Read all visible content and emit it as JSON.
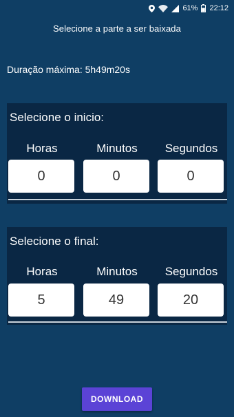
{
  "status_bar": {
    "battery": "61%",
    "time": "22:12",
    "icons": [
      "location-icon",
      "wifi-icon",
      "signal-icon",
      "battery-icon"
    ]
  },
  "header": {
    "title": "Selecione a parte a ser baixada"
  },
  "duration": {
    "text": "Duração máxima: 5h49m20s"
  },
  "start": {
    "title": "Selecione o inicio:",
    "labels": {
      "hours": "Horas",
      "minutes": "Minutos",
      "seconds": "Segundos"
    },
    "values": {
      "hours": "0",
      "minutes": "0",
      "seconds": "0"
    }
  },
  "end": {
    "title": "Selecione o final:",
    "labels": {
      "hours": "Horas",
      "minutes": "Minutos",
      "seconds": "Segundos"
    },
    "values": {
      "hours": "5",
      "minutes": "49",
      "seconds": "20"
    }
  },
  "download": {
    "label": "DOWNLOAD"
  },
  "colors": {
    "background": "#0f3e64",
    "panel": "#0a2744",
    "button": "#5b43d6"
  }
}
